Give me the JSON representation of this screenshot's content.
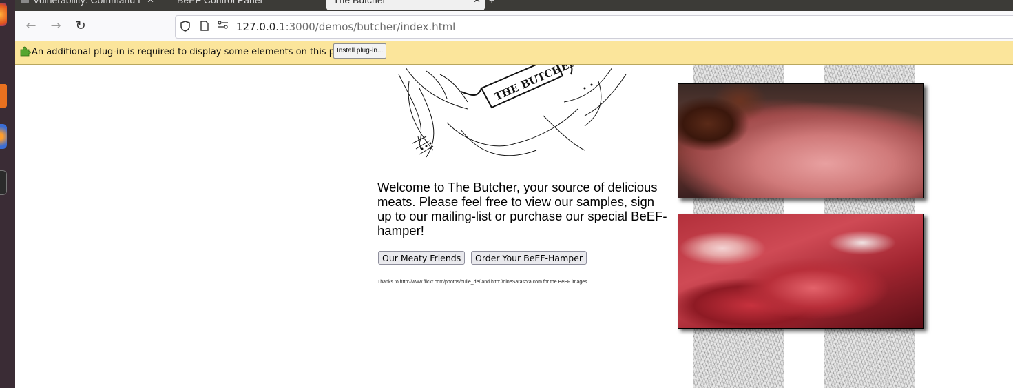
{
  "browser": {
    "tabs": [
      {
        "label": "Vulnerability: Command I"
      },
      {
        "label": "BeEF Control Panel"
      },
      {
        "label": "The Butcher",
        "active": true
      }
    ],
    "url_host": "127.0.0.1",
    "url_rest": ":3000/demos/butcher/index.html"
  },
  "plugin_bar": {
    "message": "An additional plug-in is required to display some elements on this page.",
    "button_label": "Install plug-in..."
  },
  "page": {
    "logo_text": "THE BUTCHER",
    "welcome_text": "Welcome to The Butcher, your source of delicious meats. Please feel free to view our samples, sign up to our mailing-list or purchase our special BeEF-hamper!",
    "button_meaty_friends": "Our Meaty Friends",
    "button_order_hamper": "Order Your BeEF-Hamper",
    "credit_text": "Thanks to http://www.flickr.com/photos/bulle_de/ and http://dineSarasota.com for the BeEF images"
  }
}
